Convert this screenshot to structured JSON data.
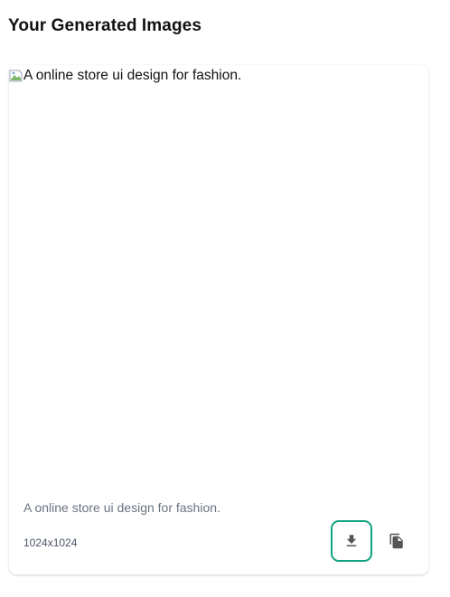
{
  "header": {
    "title": "Your Generated Images"
  },
  "card": {
    "image_alt": "A online store ui design for fashion.",
    "caption": "A online store ui design for fashion.",
    "size": "1024x1024",
    "download_icon": "download-icon",
    "copy_icon": "copy-icon"
  },
  "colors": {
    "accent": "#10a37f",
    "icon": "#555555",
    "caption": "#6b7280"
  }
}
